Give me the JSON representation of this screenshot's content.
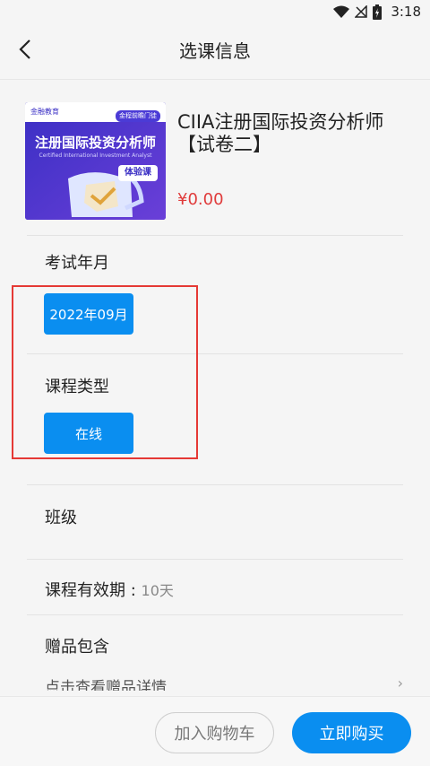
{
  "status_bar": {
    "time": "3:18"
  },
  "header": {
    "title": "选课信息"
  },
  "product": {
    "name": "CIIA注册国际投资分析师【试卷二】",
    "price": "¥0.00",
    "cover": {
      "brand": "金融教育",
      "tag": "金程前瞻门徒",
      "headline": "注册国际投资分析师",
      "subtitle": "Certified International Investment Analyst",
      "badge": "体验课"
    }
  },
  "exam_month": {
    "label": "考试年月",
    "option": "2022年09月"
  },
  "course_type": {
    "label": "课程类型",
    "option": "在线"
  },
  "class_section": {
    "label": "班级"
  },
  "validity": {
    "label": "课程有效期 : ",
    "value": "10天"
  },
  "gifts": {
    "label": "赠品包含",
    "detail": "点击查看赠品详情"
  },
  "actions": {
    "add_to_cart": "加入购物车",
    "buy_now": "立即购买"
  },
  "colors": {
    "accent": "#0a8ef0",
    "price": "#e03b3b",
    "highlight_border": "#e53935"
  }
}
